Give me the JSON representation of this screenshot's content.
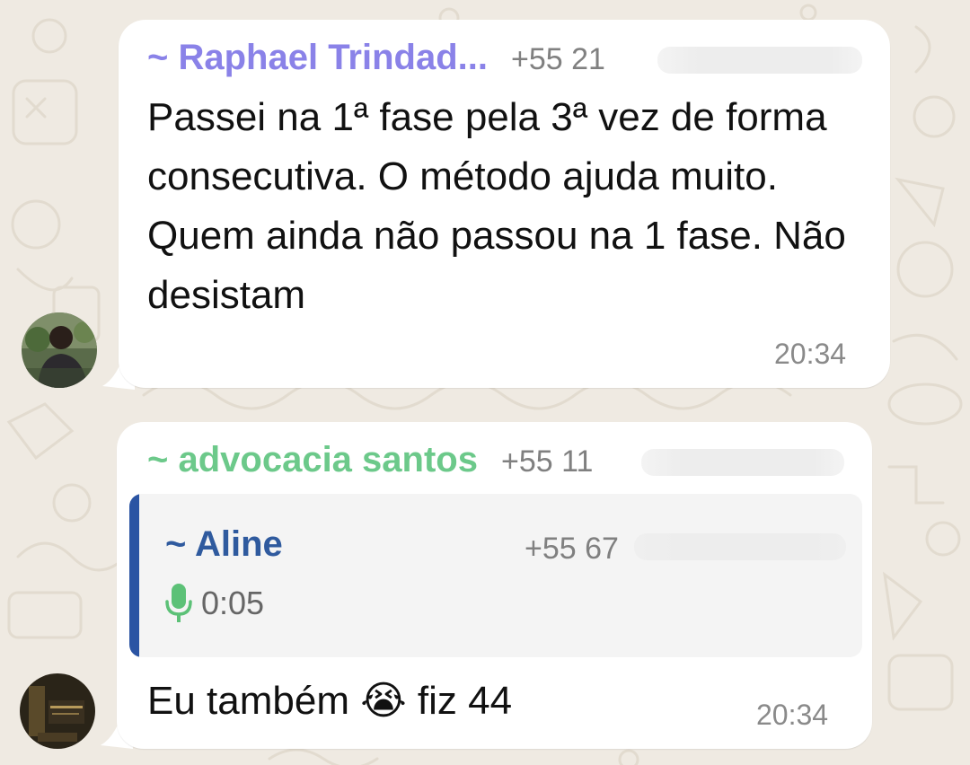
{
  "colors": {
    "background": "#efeae2",
    "bubble": "#ffffff",
    "sender1": "#8a82e8",
    "sender2": "#6cc98a",
    "quote_author": "#2f5a9e",
    "quote_bar": "#2b54a3",
    "mic_icon": "#5cc177"
  },
  "messages": [
    {
      "sender_name": "~ Raphael Trindad...",
      "sender_phone": "+55 21",
      "text": "Passei na 1ª fase pela 3ª vez de forma consecutiva. O método ajuda muito. Quem ainda não passou na 1 fase. Não desistam",
      "time": "20:34",
      "avatar_icon": "user-photo"
    },
    {
      "sender_name": "~ advocacia santos",
      "sender_phone": "+55 11",
      "quoted": {
        "author": "~ Aline",
        "phone": "+55 67",
        "type_icon": "microphone-icon",
        "duration": "0:05"
      },
      "text_before_emoji": "Eu também",
      "emoji": "😭",
      "text_after_emoji": "fiz 44",
      "time": "20:34",
      "avatar_icon": "user-photo"
    }
  ]
}
